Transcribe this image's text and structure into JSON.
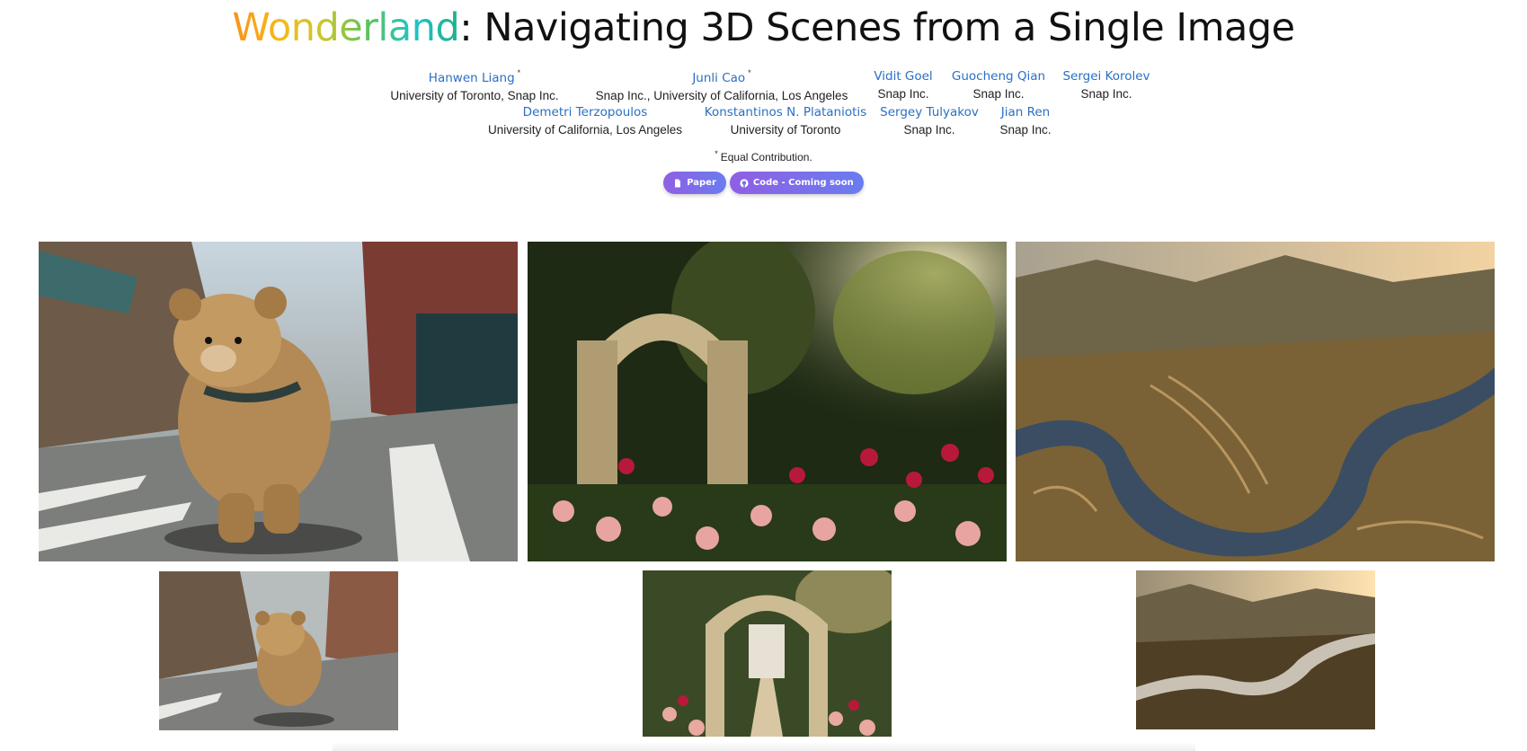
{
  "title": {
    "highlight": "Wonderland",
    "rest": ": Navigating 3D Scenes from a Single Image"
  },
  "authors": [
    {
      "name": "Hanwen Liang",
      "mark": "*",
      "affiliation": "University of Toronto, Snap Inc."
    },
    {
      "name": "Junli Cao",
      "mark": "*",
      "affiliation": "Snap Inc., University of California, Los Angeles"
    },
    {
      "name": "Vidit Goel",
      "mark": "",
      "affiliation": "Snap Inc."
    },
    {
      "name": "Guocheng Qian",
      "mark": "",
      "affiliation": "Snap Inc."
    },
    {
      "name": "Sergei Korolev",
      "mark": "",
      "affiliation": "Snap Inc."
    },
    {
      "name": "Demetri Terzopoulos",
      "mark": "",
      "affiliation": "University of California, Los Angeles"
    },
    {
      "name": "Konstantinos N. Plataniotis",
      "mark": "",
      "affiliation": "University of Toronto"
    },
    {
      "name": "Sergey Tulyakov",
      "mark": "",
      "affiliation": "Snap Inc."
    },
    {
      "name": "Jian Ren",
      "mark": "",
      "affiliation": "Snap Inc."
    }
  ],
  "note": {
    "mark": "*",
    "text": "Equal Contribution."
  },
  "buttons": {
    "paper": {
      "label": "Paper",
      "icon": "file-icon"
    },
    "code": {
      "label": "Code - Coming soon",
      "icon": "github-icon"
    }
  },
  "gallery": {
    "large": [
      {
        "subject": "teddy bear walking on city street"
      },
      {
        "subject": "stone arch in rose garden"
      },
      {
        "subject": "aerial view of winding river through terraced mountains"
      }
    ],
    "small": [
      {
        "subject": "teddy bear walking on city street"
      },
      {
        "subject": "stone arch with fountain pavilion in rose garden"
      },
      {
        "subject": "aerial view of winding river at sunset"
      }
    ]
  }
}
